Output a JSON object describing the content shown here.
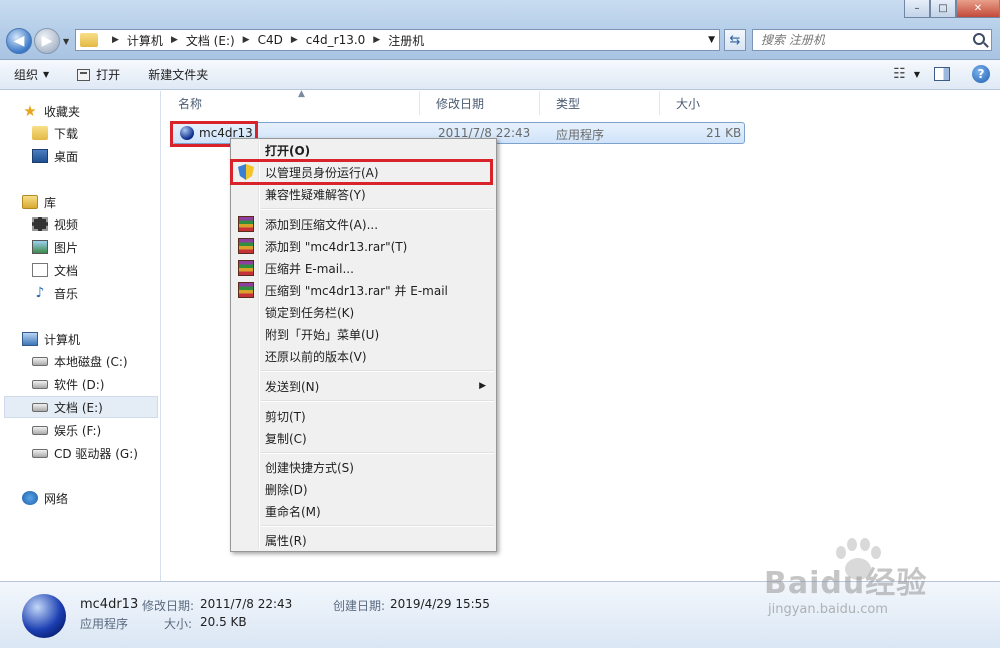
{
  "address": {
    "crumbs": [
      "计算机",
      "文档 (E:)",
      "C4D",
      "c4d_r13.0",
      "注册机"
    ],
    "search_placeholder": "搜索 注册机"
  },
  "toolbar": {
    "organize": "组织",
    "open": "打开",
    "new_folder": "新建文件夹"
  },
  "nav_pane": {
    "favorites": "收藏夹",
    "downloads": "下载",
    "desktop": "桌面",
    "libraries": "库",
    "videos": "视频",
    "pictures": "图片",
    "documents": "文档",
    "music": "音乐",
    "computer": "计算机",
    "drive_c": "本地磁盘 (C:)",
    "drive_d": "软件 (D:)",
    "drive_e": "文档 (E:)",
    "drive_f": "娱乐 (F:)",
    "drive_g": "CD 驱动器 (G:)",
    "network": "网络"
  },
  "columns": {
    "name": "名称",
    "modified": "修改日期",
    "type": "类型",
    "size": "大小"
  },
  "file": {
    "name": "mc4dr13",
    "modified": "2011/7/8 22:43",
    "type": "应用程序",
    "size": "21 KB"
  },
  "context_menu": {
    "open": "打开(O)",
    "run_as_admin": "以管理员身份运行(A)",
    "troubleshoot": "兼容性疑难解答(Y)",
    "add_to_archive": "添加到压缩文件(A)...",
    "add_to_rar": "添加到 \"mc4dr13.rar\"(T)",
    "compress_email": "压缩并 E-mail...",
    "compress_rar_email": "压缩到 \"mc4dr13.rar\" 并 E-mail",
    "pin_taskbar": "锁定到任务栏(K)",
    "pin_start": "附到「开始」菜单(U)",
    "restore_versions": "还原以前的版本(V)",
    "send_to": "发送到(N)",
    "cut": "剪切(T)",
    "copy": "复制(C)",
    "create_shortcut": "创建快捷方式(S)",
    "delete": "删除(D)",
    "rename": "重命名(M)",
    "properties": "属性(R)"
  },
  "details": {
    "name": "mc4dr13",
    "type": "应用程序",
    "modified_label": "修改日期:",
    "modified_value": "2011/7/8 22:43",
    "created_label": "创建日期:",
    "created_value": "2019/4/29 15:55",
    "size_label": "大小:",
    "size_value": "20.5 KB"
  },
  "watermark": {
    "logo": "Baidu经验",
    "url": "jingyan.baidu.com"
  },
  "colors": {
    "highlight_red": "#d8232a",
    "selection_blue": "#cfe3fa"
  }
}
